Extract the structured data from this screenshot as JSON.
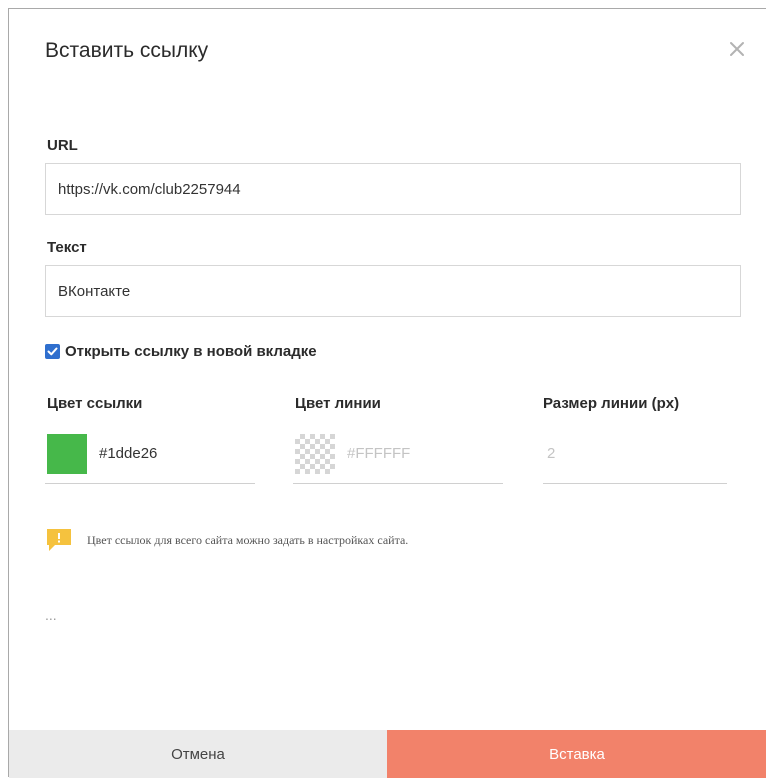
{
  "dialog": {
    "title": "Вставить ссылку",
    "close_icon": "close-icon"
  },
  "url": {
    "label": "URL",
    "value": "https://vk.com/club2257944"
  },
  "text": {
    "label": "Текст",
    "value": "ВКонтакте"
  },
  "new_tab": {
    "label": "Открыть ссылку в новой вкладке",
    "checked": true
  },
  "link_color": {
    "label": "Цвет ссылки",
    "value": "#1dde26",
    "swatch": "#46b84a"
  },
  "line_color": {
    "label": "Цвет линии",
    "placeholder": "#FFFFFF"
  },
  "line_size": {
    "label": "Размер линии (px)",
    "placeholder": "2"
  },
  "note": {
    "icon": "warning-icon",
    "icon_color": "#f5c23e",
    "text": "Цвет ссылок для всего сайта можно задать в настройках сайта."
  },
  "ellipsis": "...",
  "footer": {
    "cancel_label": "Отмена",
    "insert_label": "Вставка",
    "insert_color": "#f2826a"
  }
}
